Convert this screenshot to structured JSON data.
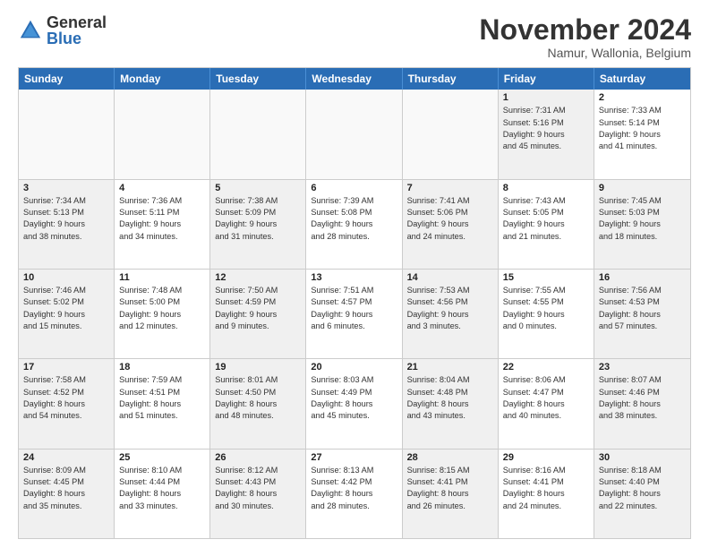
{
  "logo": {
    "general": "General",
    "blue": "Blue"
  },
  "title": "November 2024",
  "subtitle": "Namur, Wallonia, Belgium",
  "days_of_week": [
    "Sunday",
    "Monday",
    "Tuesday",
    "Wednesday",
    "Thursday",
    "Friday",
    "Saturday"
  ],
  "weeks": [
    [
      {
        "day": "",
        "info": "",
        "shaded": false,
        "empty": true
      },
      {
        "day": "",
        "info": "",
        "shaded": false,
        "empty": true
      },
      {
        "day": "",
        "info": "",
        "shaded": false,
        "empty": true
      },
      {
        "day": "",
        "info": "",
        "shaded": false,
        "empty": true
      },
      {
        "day": "",
        "info": "",
        "shaded": false,
        "empty": true
      },
      {
        "day": "1",
        "info": "Sunrise: 7:31 AM\nSunset: 5:16 PM\nDaylight: 9 hours\nand 45 minutes.",
        "shaded": true,
        "empty": false
      },
      {
        "day": "2",
        "info": "Sunrise: 7:33 AM\nSunset: 5:14 PM\nDaylight: 9 hours\nand 41 minutes.",
        "shaded": false,
        "empty": false
      }
    ],
    [
      {
        "day": "3",
        "info": "Sunrise: 7:34 AM\nSunset: 5:13 PM\nDaylight: 9 hours\nand 38 minutes.",
        "shaded": true,
        "empty": false
      },
      {
        "day": "4",
        "info": "Sunrise: 7:36 AM\nSunset: 5:11 PM\nDaylight: 9 hours\nand 34 minutes.",
        "shaded": false,
        "empty": false
      },
      {
        "day": "5",
        "info": "Sunrise: 7:38 AM\nSunset: 5:09 PM\nDaylight: 9 hours\nand 31 minutes.",
        "shaded": true,
        "empty": false
      },
      {
        "day": "6",
        "info": "Sunrise: 7:39 AM\nSunset: 5:08 PM\nDaylight: 9 hours\nand 28 minutes.",
        "shaded": false,
        "empty": false
      },
      {
        "day": "7",
        "info": "Sunrise: 7:41 AM\nSunset: 5:06 PM\nDaylight: 9 hours\nand 24 minutes.",
        "shaded": true,
        "empty": false
      },
      {
        "day": "8",
        "info": "Sunrise: 7:43 AM\nSunset: 5:05 PM\nDaylight: 9 hours\nand 21 minutes.",
        "shaded": false,
        "empty": false
      },
      {
        "day": "9",
        "info": "Sunrise: 7:45 AM\nSunset: 5:03 PM\nDaylight: 9 hours\nand 18 minutes.",
        "shaded": true,
        "empty": false
      }
    ],
    [
      {
        "day": "10",
        "info": "Sunrise: 7:46 AM\nSunset: 5:02 PM\nDaylight: 9 hours\nand 15 minutes.",
        "shaded": true,
        "empty": false
      },
      {
        "day": "11",
        "info": "Sunrise: 7:48 AM\nSunset: 5:00 PM\nDaylight: 9 hours\nand 12 minutes.",
        "shaded": false,
        "empty": false
      },
      {
        "day": "12",
        "info": "Sunrise: 7:50 AM\nSunset: 4:59 PM\nDaylight: 9 hours\nand 9 minutes.",
        "shaded": true,
        "empty": false
      },
      {
        "day": "13",
        "info": "Sunrise: 7:51 AM\nSunset: 4:57 PM\nDaylight: 9 hours\nand 6 minutes.",
        "shaded": false,
        "empty": false
      },
      {
        "day": "14",
        "info": "Sunrise: 7:53 AM\nSunset: 4:56 PM\nDaylight: 9 hours\nand 3 minutes.",
        "shaded": true,
        "empty": false
      },
      {
        "day": "15",
        "info": "Sunrise: 7:55 AM\nSunset: 4:55 PM\nDaylight: 9 hours\nand 0 minutes.",
        "shaded": false,
        "empty": false
      },
      {
        "day": "16",
        "info": "Sunrise: 7:56 AM\nSunset: 4:53 PM\nDaylight: 8 hours\nand 57 minutes.",
        "shaded": true,
        "empty": false
      }
    ],
    [
      {
        "day": "17",
        "info": "Sunrise: 7:58 AM\nSunset: 4:52 PM\nDaylight: 8 hours\nand 54 minutes.",
        "shaded": true,
        "empty": false
      },
      {
        "day": "18",
        "info": "Sunrise: 7:59 AM\nSunset: 4:51 PM\nDaylight: 8 hours\nand 51 minutes.",
        "shaded": false,
        "empty": false
      },
      {
        "day": "19",
        "info": "Sunrise: 8:01 AM\nSunset: 4:50 PM\nDaylight: 8 hours\nand 48 minutes.",
        "shaded": true,
        "empty": false
      },
      {
        "day": "20",
        "info": "Sunrise: 8:03 AM\nSunset: 4:49 PM\nDaylight: 8 hours\nand 45 minutes.",
        "shaded": false,
        "empty": false
      },
      {
        "day": "21",
        "info": "Sunrise: 8:04 AM\nSunset: 4:48 PM\nDaylight: 8 hours\nand 43 minutes.",
        "shaded": true,
        "empty": false
      },
      {
        "day": "22",
        "info": "Sunrise: 8:06 AM\nSunset: 4:47 PM\nDaylight: 8 hours\nand 40 minutes.",
        "shaded": false,
        "empty": false
      },
      {
        "day": "23",
        "info": "Sunrise: 8:07 AM\nSunset: 4:46 PM\nDaylight: 8 hours\nand 38 minutes.",
        "shaded": true,
        "empty": false
      }
    ],
    [
      {
        "day": "24",
        "info": "Sunrise: 8:09 AM\nSunset: 4:45 PM\nDaylight: 8 hours\nand 35 minutes.",
        "shaded": true,
        "empty": false
      },
      {
        "day": "25",
        "info": "Sunrise: 8:10 AM\nSunset: 4:44 PM\nDaylight: 8 hours\nand 33 minutes.",
        "shaded": false,
        "empty": false
      },
      {
        "day": "26",
        "info": "Sunrise: 8:12 AM\nSunset: 4:43 PM\nDaylight: 8 hours\nand 30 minutes.",
        "shaded": true,
        "empty": false
      },
      {
        "day": "27",
        "info": "Sunrise: 8:13 AM\nSunset: 4:42 PM\nDaylight: 8 hours\nand 28 minutes.",
        "shaded": false,
        "empty": false
      },
      {
        "day": "28",
        "info": "Sunrise: 8:15 AM\nSunset: 4:41 PM\nDaylight: 8 hours\nand 26 minutes.",
        "shaded": true,
        "empty": false
      },
      {
        "day": "29",
        "info": "Sunrise: 8:16 AM\nSunset: 4:41 PM\nDaylight: 8 hours\nand 24 minutes.",
        "shaded": false,
        "empty": false
      },
      {
        "day": "30",
        "info": "Sunrise: 8:18 AM\nSunset: 4:40 PM\nDaylight: 8 hours\nand 22 minutes.",
        "shaded": true,
        "empty": false
      }
    ]
  ]
}
